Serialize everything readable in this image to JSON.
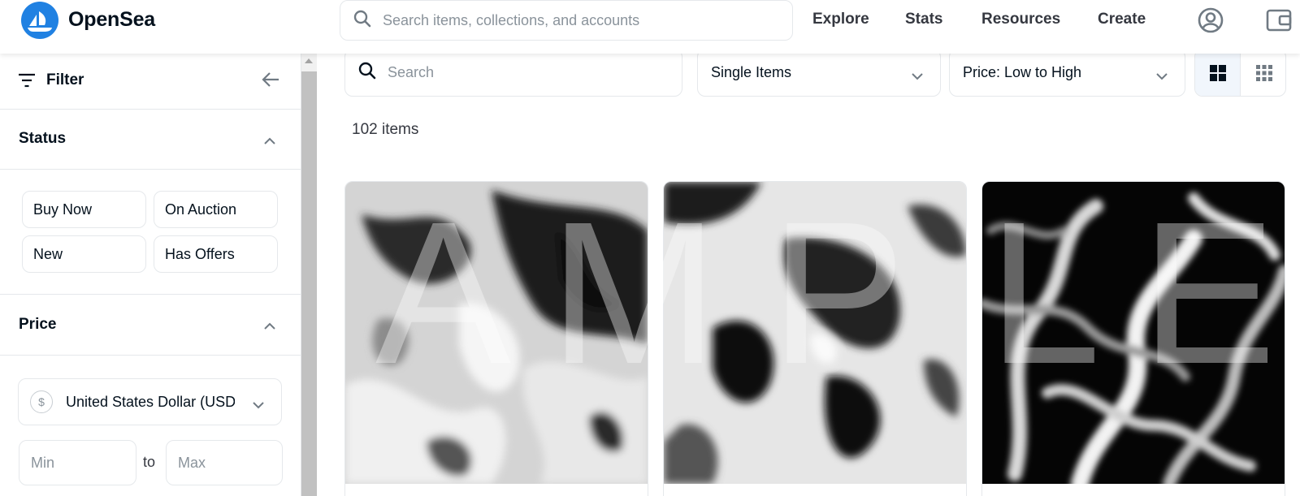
{
  "header": {
    "brand": "OpenSea",
    "search_placeholder": "Search items, collections, and accounts",
    "nav": [
      "Explore",
      "Stats",
      "Resources",
      "Create"
    ],
    "icons": [
      "account-icon",
      "wallet-icon"
    ]
  },
  "sidebar": {
    "filter_label": "Filter",
    "status": {
      "title": "Status",
      "options": [
        "Buy Now",
        "On Auction",
        "New",
        "Has Offers"
      ]
    },
    "price": {
      "title": "Price",
      "currency_symbol": "$",
      "currency": "United States Dollar (USD)",
      "min_placeholder": "Min",
      "to_label": "to",
      "max_placeholder": "Max"
    }
  },
  "toolbar": {
    "search_placeholder": "Search",
    "item_type": "Single Items",
    "sort": "Price: Low to High"
  },
  "results": {
    "count_label": "102 items"
  },
  "watermark": [
    "A",
    "M",
    "P",
    "L",
    "E"
  ],
  "colors": {
    "brand_blue": "#2081e2",
    "text": "#04111d",
    "border": "#e5e8eb",
    "selected_view_bg": "#f1f6fc"
  }
}
